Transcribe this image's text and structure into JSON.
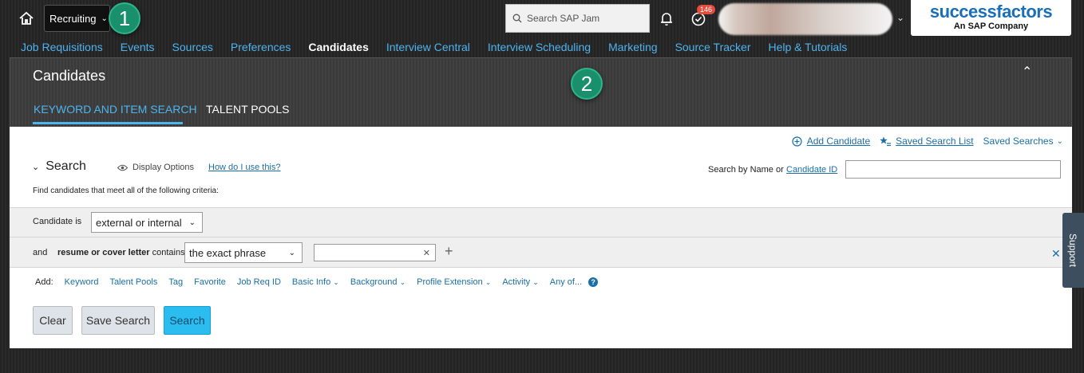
{
  "header": {
    "module_label": "Recruiting",
    "jam_search_placeholder": "Search SAP Jam",
    "todo_count": "146",
    "logo_brand": "successfactors",
    "logo_sub": "An SAP Company",
    "step_badges": [
      "1",
      "2"
    ]
  },
  "nav": {
    "items": [
      {
        "label": "Job Requisitions",
        "active": false
      },
      {
        "label": "Events",
        "active": false
      },
      {
        "label": "Sources",
        "active": false
      },
      {
        "label": "Preferences",
        "active": false
      },
      {
        "label": "Candidates",
        "active": true
      },
      {
        "label": "Interview Central",
        "active": false
      },
      {
        "label": "Interview Scheduling",
        "active": false
      },
      {
        "label": "Marketing",
        "active": false
      },
      {
        "label": "Source Tracker",
        "active": false
      },
      {
        "label": "Help & Tutorials",
        "active": false
      }
    ]
  },
  "page": {
    "title": "Candidates",
    "tabs": [
      {
        "label": "KEYWORD AND ITEM SEARCH",
        "active": true
      },
      {
        "label": "TALENT POOLS",
        "active": false
      }
    ]
  },
  "actions": {
    "add_candidate": "Add Candidate",
    "saved_search_list": "Saved Search List",
    "saved_searches": "Saved Searches"
  },
  "search": {
    "heading": "Search",
    "display_options": "Display Options",
    "how_do_i": "How do I use this?",
    "find_text": "Find candidates that meet all of the following criteria:",
    "name_label": "Search by Name or",
    "candidate_id_link": "Candidate ID",
    "name_value": ""
  },
  "criteria": {
    "row1_label": "Candidate is",
    "row1_select": "external or internal",
    "row2_and": "and",
    "row2_field": "resume or cover letter",
    "row2_contains": "contains",
    "row2_select": "the exact phrase",
    "row2_value": ""
  },
  "add_options": {
    "label": "Add:",
    "items": [
      "Keyword",
      "Talent Pools",
      "Tag",
      "Favorite",
      "Job Req ID",
      "Basic Info",
      "Background",
      "Profile Extension",
      "Activity",
      "Any of..."
    ],
    "dropdown": [
      false,
      false,
      false,
      false,
      false,
      true,
      true,
      true,
      true,
      false
    ]
  },
  "buttons": {
    "clear": "Clear",
    "save_search": "Save Search",
    "search": "Search"
  },
  "support_label": "Support",
  "colors": {
    "nav_link": "#4fb3ee",
    "link": "#1a6fa6",
    "primary_button": "#2bbdf0",
    "badge_green": "#1a8f6c",
    "notification_red": "#e74c3c"
  }
}
